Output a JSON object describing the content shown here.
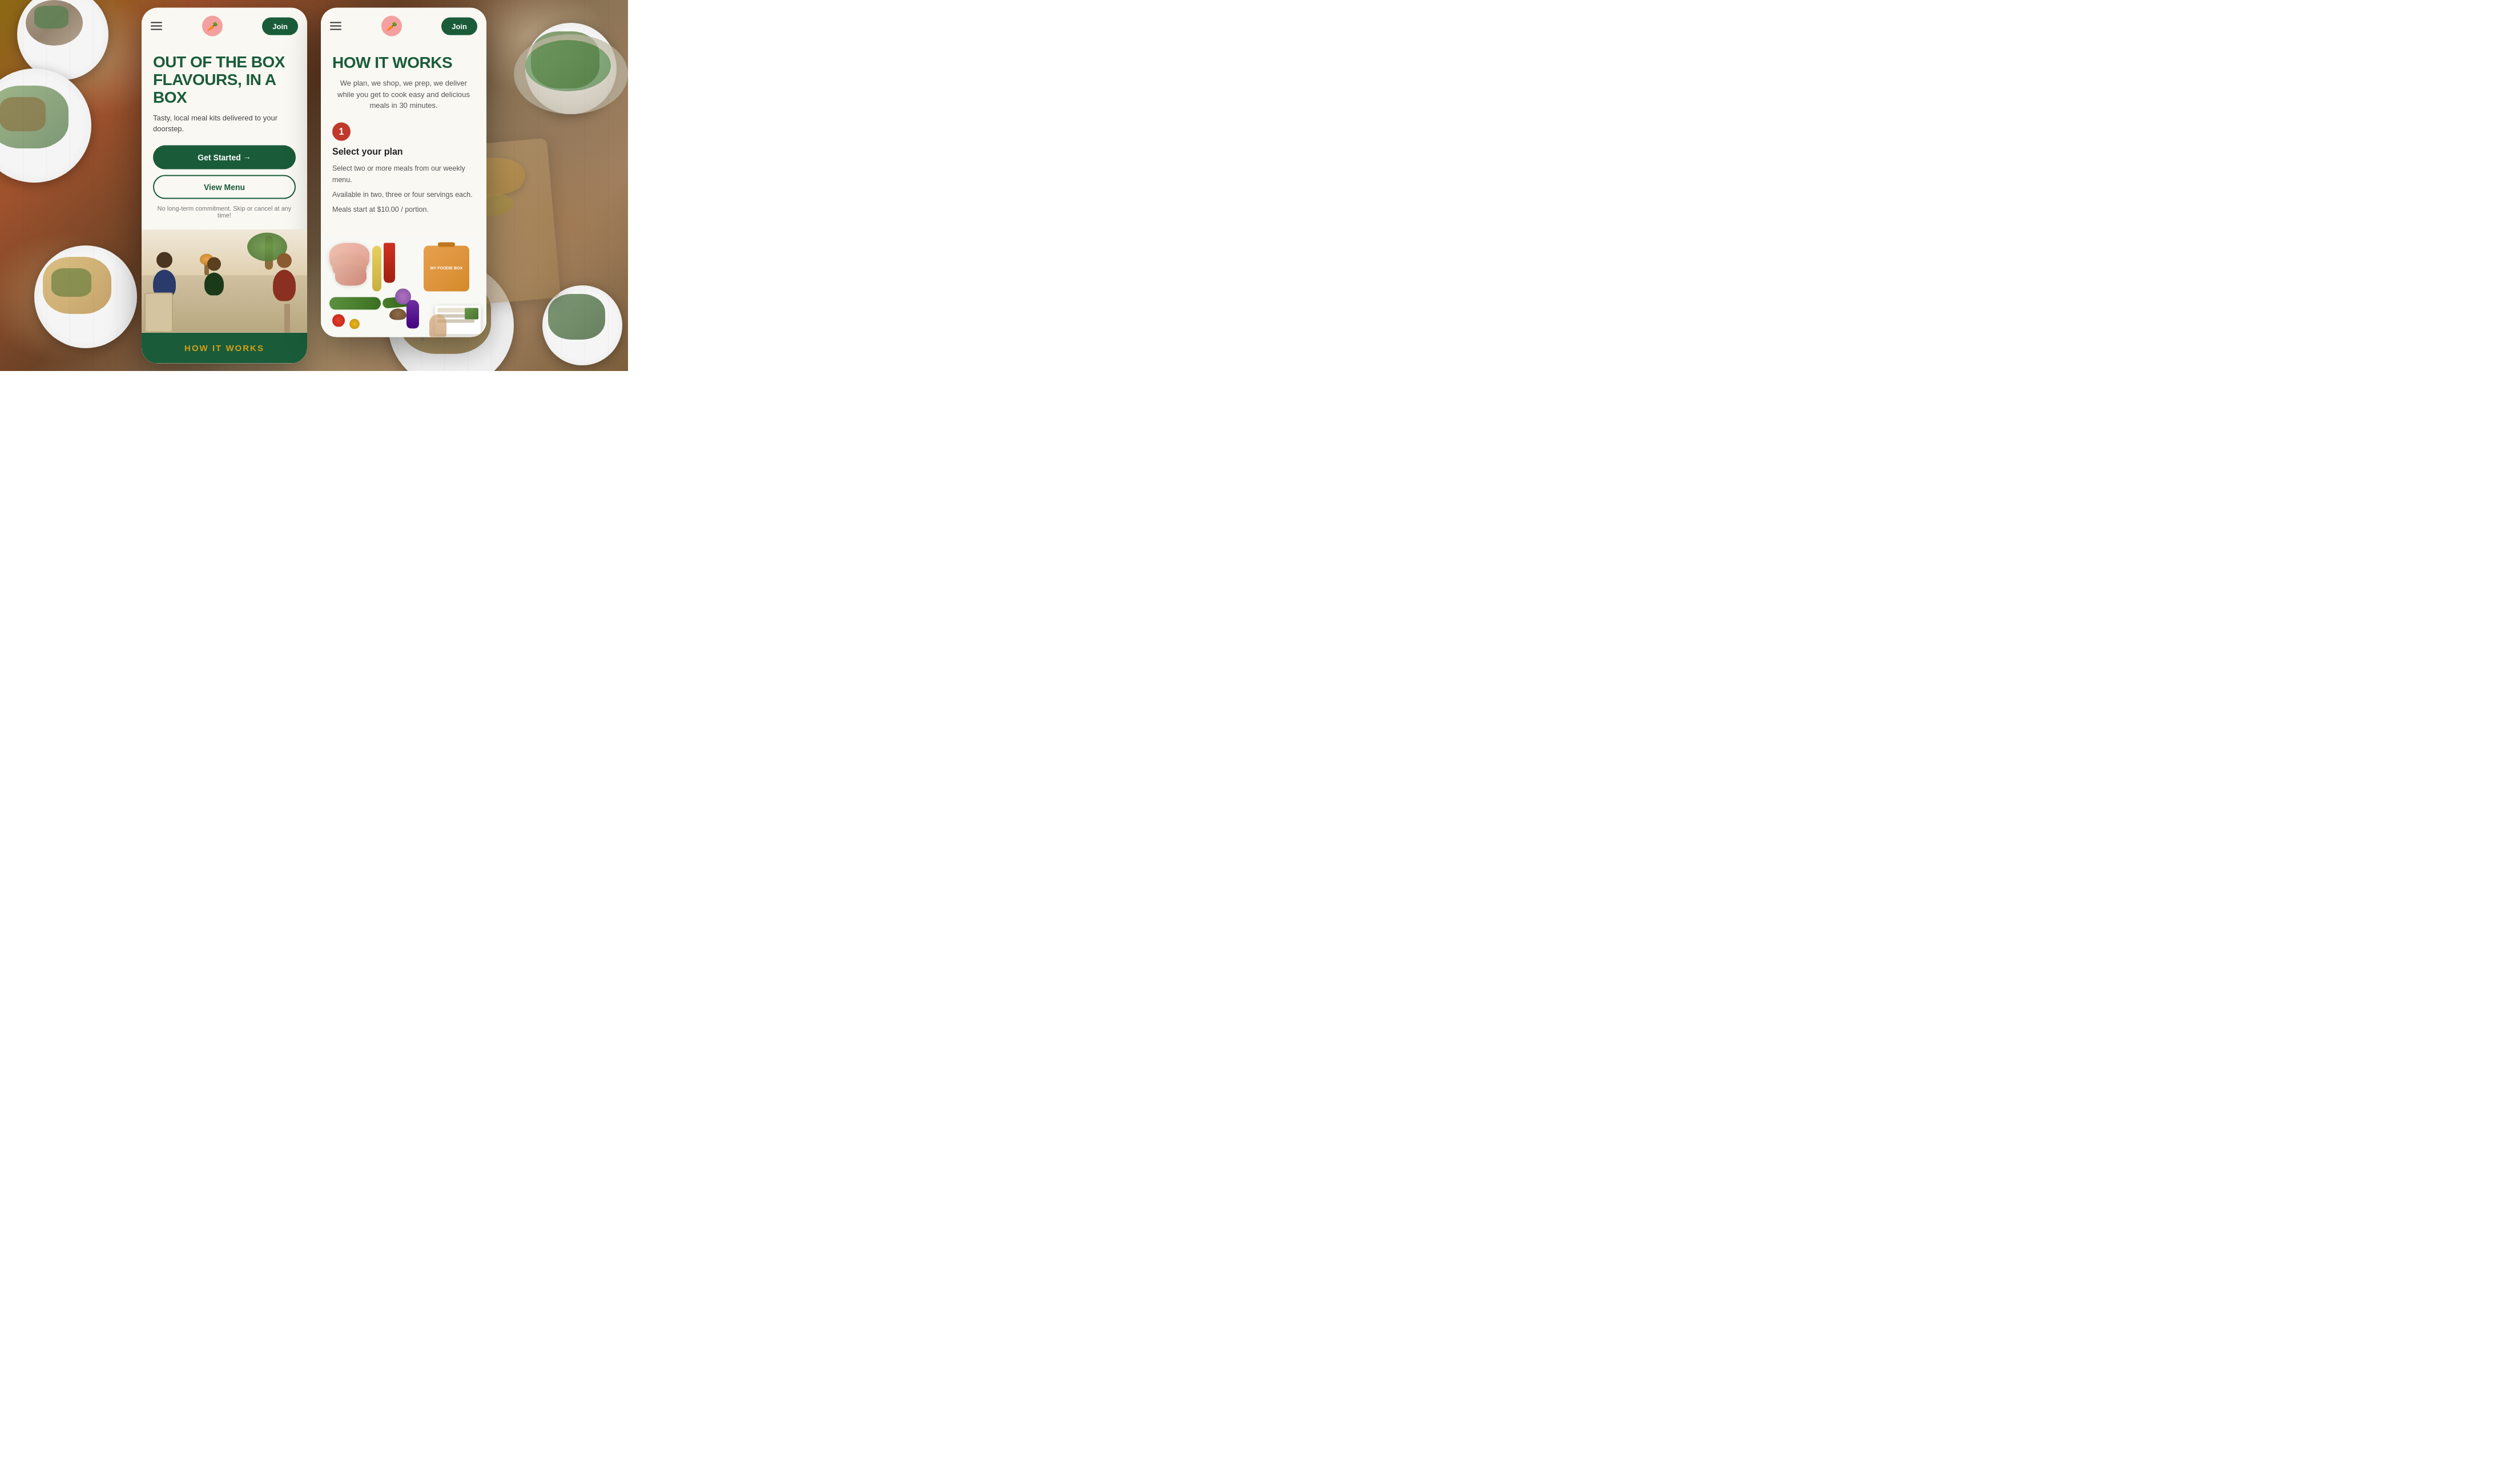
{
  "background": {
    "color": "#8B6914"
  },
  "card1": {
    "nav": {
      "join_label": "Join"
    },
    "hero": {
      "title": "OUT OF THE BOX FLAVOURS, IN A BOX",
      "subtitle": "Tasty, local meal kits delivered to your doorstep.",
      "get_started_label": "Get Started →",
      "view_menu_label": "View Menu",
      "commitment_text": "No long-term commitment. Skip or cancel at any time!"
    },
    "footer": {
      "how_it_works_label": "HOW IT WORKS"
    }
  },
  "card2": {
    "nav": {
      "join_label": "Join"
    },
    "how_it_works": {
      "title": "HOW IT WORKS",
      "description": "We plan, we shop, we prep, we deliver while you get to cook easy and delicious meals in 30 minutes.",
      "step": {
        "number": "1",
        "title": "Select your plan",
        "descriptions": [
          "Select two or more meals from our weekly menu.",
          "Available in two, three or four servings each.",
          "Meals start at $10.00 / portion."
        ]
      },
      "product_box_label": "MY FOODIE BOX"
    }
  },
  "icons": {
    "hamburger": "☰",
    "carrot": "🥕",
    "arrow_right": "→"
  }
}
